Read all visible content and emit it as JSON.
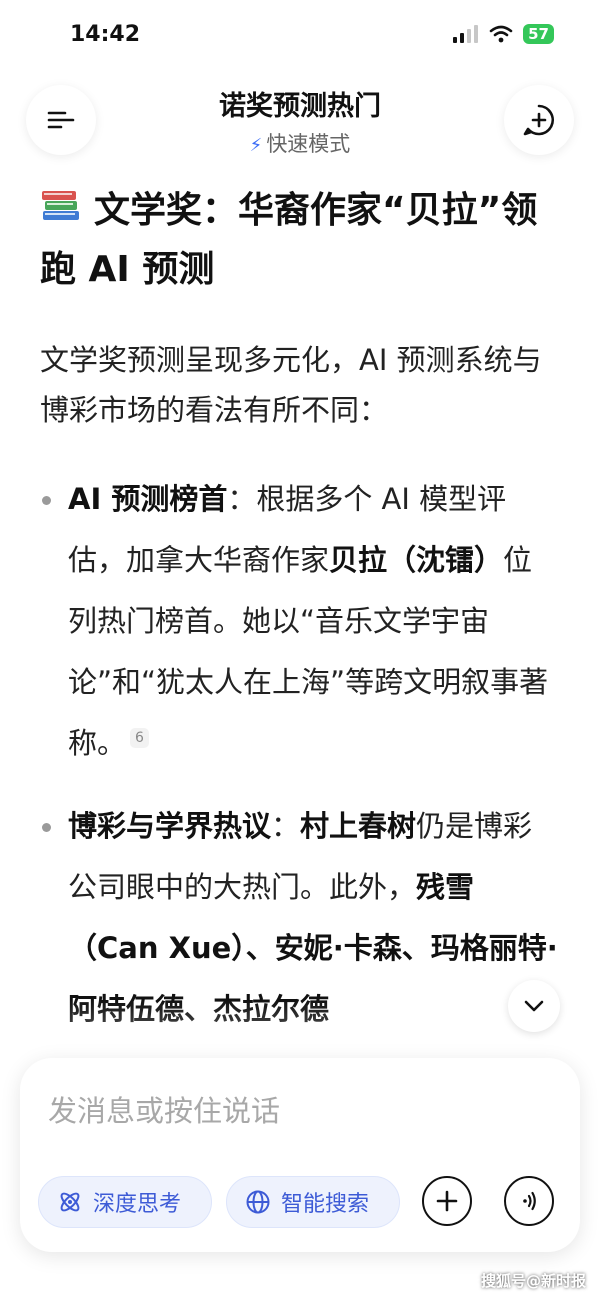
{
  "status_bar": {
    "time": "14:42",
    "battery": "57"
  },
  "header": {
    "title": "诺奖预测热门",
    "mode": "快速模式"
  },
  "content": {
    "heading": "文学奖：华裔作家“贝拉”领跑 AI 预测",
    "intro": "文学奖预测呈现多元化，AI 预测系统与博彩市场的看法有所不同：",
    "bullets": [
      {
        "b1": "AI 预测榜首",
        "t1": "：根据多个 AI 模型评估，加拿大华裔作家",
        "b2": "贝拉（沈镭）",
        "t2": "位列热门榜首。她以“音乐文学宇宙论”和“犹太人在上海”等跨文明叙事著称。",
        "cite": "6"
      },
      {
        "b1": "博彩与学界热议",
        "t1": "：",
        "b2": "村上春树",
        "t2": "仍是博彩公司眼中的大热门。此外，",
        "b3": "残雪（Can Xue）、安妮·卡森、玛格丽特·阿特伍德、杰拉尔德",
        "t3": ""
      }
    ]
  },
  "composer": {
    "placeholder": "发消息或按住说话",
    "deep_think": "深度思考",
    "smart_search": "智能搜索"
  },
  "watermark": "搜狐号@新时报",
  "colors": {
    "accent": "#3d5bd6",
    "battery": "#34c759"
  }
}
